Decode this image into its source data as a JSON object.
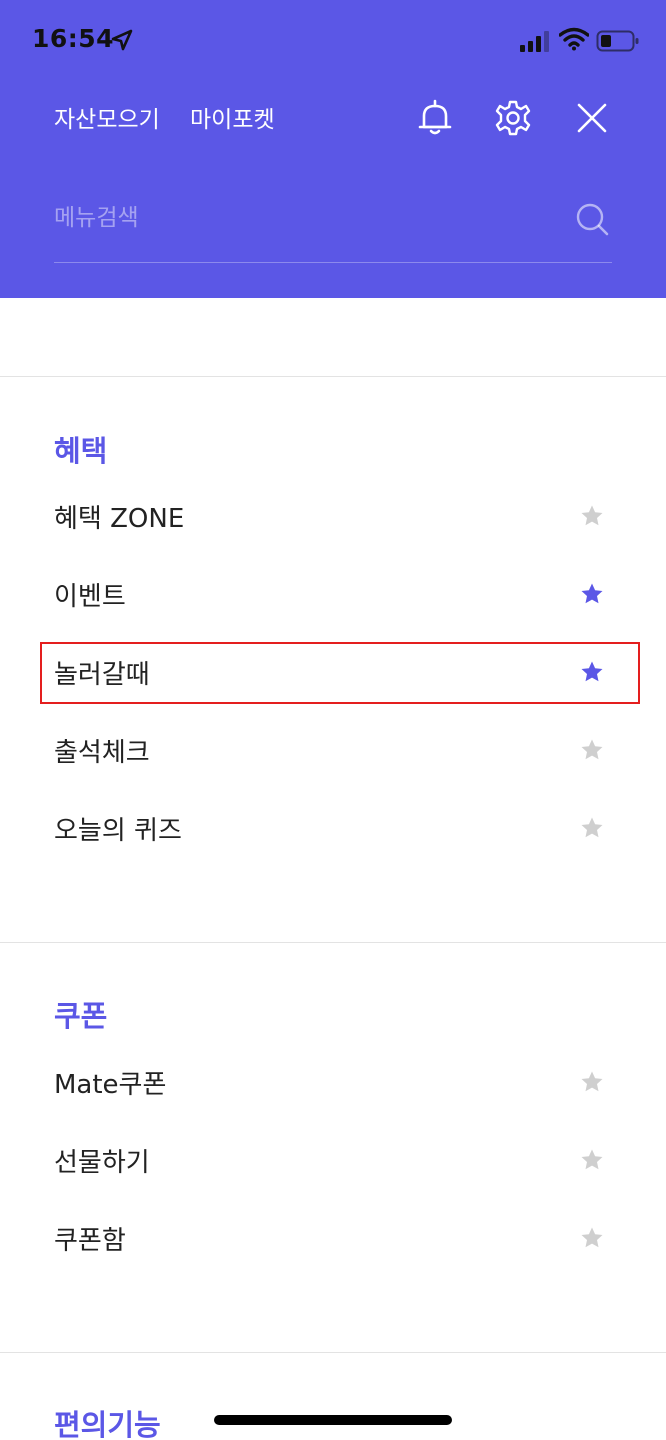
{
  "status_bar": {
    "time": "16:54"
  },
  "header": {
    "nav": [
      {
        "label": "자산모으기"
      },
      {
        "label": "마이포켓"
      }
    ],
    "icons": [
      "bell-icon",
      "gear-icon",
      "close-icon"
    ],
    "search": {
      "placeholder": "메뉴검색",
      "value": ""
    }
  },
  "colors": {
    "brand": "#5b57e6",
    "star_active": "#5b57e6",
    "star_inactive": "#cfcfcf",
    "highlight": "#e41e1e"
  },
  "sections": [
    {
      "title": "혜택",
      "items": [
        {
          "label": "혜택 ZONE",
          "favorite": false
        },
        {
          "label": "이벤트",
          "favorite": true
        },
        {
          "label": "놀러갈때",
          "favorite": true
        },
        {
          "label": "출석체크",
          "favorite": false
        },
        {
          "label": "오늘의 퀴즈",
          "favorite": false
        }
      ]
    },
    {
      "title": "쿠폰",
      "items": [
        {
          "label": "Mate쿠폰",
          "favorite": false
        },
        {
          "label": "선물하기",
          "favorite": false
        },
        {
          "label": "쿠폰함",
          "favorite": false
        }
      ]
    },
    {
      "title": "편의기능",
      "items": []
    }
  ]
}
